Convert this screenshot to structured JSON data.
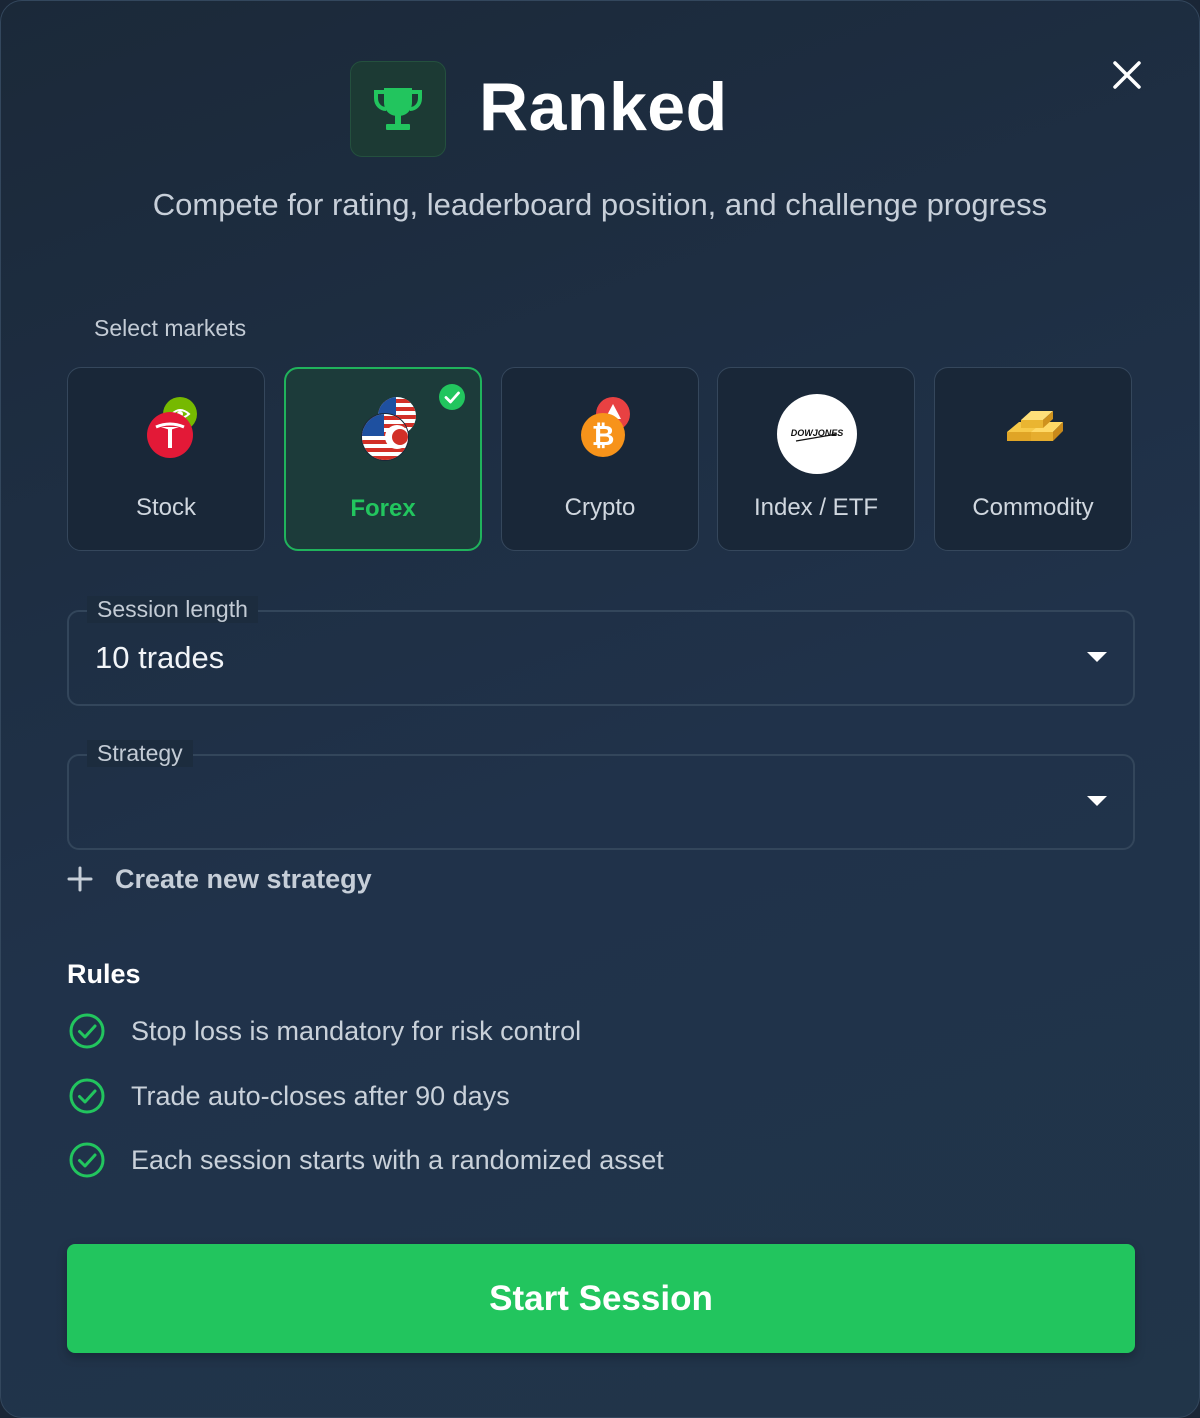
{
  "header": {
    "icon": "trophy-icon",
    "title": "Ranked",
    "subtitle": "Compete for rating, leaderboard position, and challenge progress",
    "close_icon": "close-icon"
  },
  "markets": {
    "label": "Select markets",
    "items": [
      {
        "label": "Stock",
        "icon": "stock-logos-icon",
        "selected": false
      },
      {
        "label": "Forex",
        "icon": "currency-flags-icon",
        "selected": true
      },
      {
        "label": "Crypto",
        "icon": "crypto-coins-icon",
        "selected": false
      },
      {
        "label": "Index / ETF",
        "icon": "dow-jones-logo",
        "selected": false
      },
      {
        "label": "Commodity",
        "icon": "gold-bars-icon",
        "selected": false
      }
    ],
    "index_logo_text": "DOWJONES"
  },
  "session_length": {
    "label": "Session length",
    "value": "10 trades"
  },
  "strategy": {
    "label": "Strategy",
    "value": ""
  },
  "create_strategy": {
    "label": "Create new strategy"
  },
  "rules": {
    "title": "Rules",
    "items": [
      "Stop loss is mandatory for risk control",
      "Trade auto-closes after 90 days",
      "Each session starts with a randomized asset"
    ]
  },
  "start_button": {
    "label": "Start Session"
  },
  "colors": {
    "accent": "#22c55e",
    "background": "#1f3247",
    "text_muted": "#c3cbd5"
  }
}
